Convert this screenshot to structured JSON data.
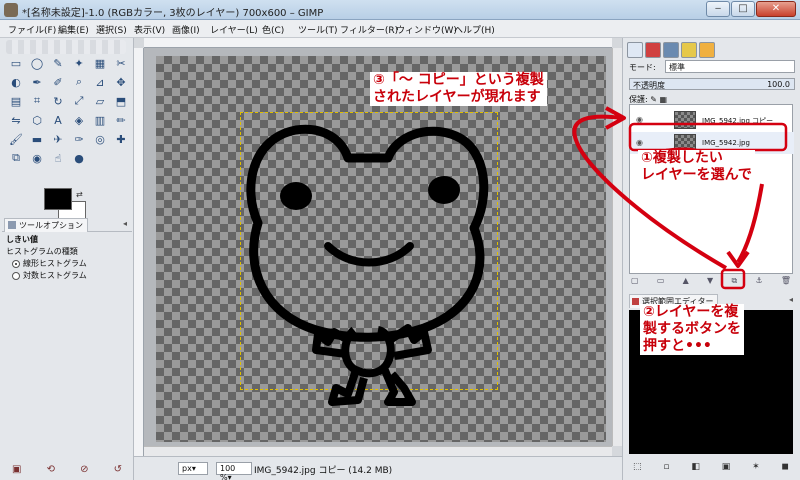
{
  "window": {
    "title": "*[名称未設定]-1.0 (RGBカラー, 3枚のレイヤー) 700x600 – GIMP",
    "minimize_icon": "minimize-icon",
    "maximize_icon": "maximize-icon",
    "close_icon": "close-icon",
    "minimize_glyph": "‒",
    "maximize_glyph": "□",
    "close_glyph": "✕"
  },
  "menubar": {
    "items": [
      "ファイル(F)",
      "編集(E)",
      "選択(S)",
      "表示(V)",
      "画像(I)",
      "レイヤー(L)",
      "色(C)",
      "ツール(T)",
      "フィルター(R)",
      "ウィンドウ(W)",
      "ヘルプ(H)"
    ]
  },
  "toolbox": {
    "tools": [
      {
        "icon": "rect-select-icon",
        "glyph": "▭"
      },
      {
        "icon": "ellipse-select-icon",
        "glyph": "◯"
      },
      {
        "icon": "lasso-select-icon",
        "glyph": "✎"
      },
      {
        "icon": "fuzzy-select-icon",
        "glyph": "✦"
      },
      {
        "icon": "color-select-icon",
        "glyph": "▦"
      },
      {
        "icon": "scissors-icon",
        "glyph": "✂"
      },
      {
        "icon": "foreground-select-icon",
        "glyph": "◐"
      },
      {
        "icon": "paths-icon",
        "glyph": "✒"
      },
      {
        "icon": "color-picker-icon",
        "glyph": "✐"
      },
      {
        "icon": "zoom-icon",
        "glyph": "⌕"
      },
      {
        "icon": "measure-icon",
        "glyph": "⊿"
      },
      {
        "icon": "move-icon",
        "glyph": "✥"
      },
      {
        "icon": "align-icon",
        "glyph": "▤"
      },
      {
        "icon": "crop-icon",
        "glyph": "⌗"
      },
      {
        "icon": "rotate-icon",
        "glyph": "↻"
      },
      {
        "icon": "scale-icon",
        "glyph": "⤢"
      },
      {
        "icon": "shear-icon",
        "glyph": "▱"
      },
      {
        "icon": "perspective-icon",
        "glyph": "⬒"
      },
      {
        "icon": "flip-icon",
        "glyph": "⇋"
      },
      {
        "icon": "cage-icon",
        "glyph": "⬡"
      },
      {
        "icon": "text-icon",
        "glyph": "A"
      },
      {
        "icon": "bucket-fill-icon",
        "glyph": "◈"
      },
      {
        "icon": "blend-icon",
        "glyph": "▥"
      },
      {
        "icon": "pencil-icon",
        "glyph": "✏"
      },
      {
        "icon": "paintbrush-icon",
        "glyph": "🖌"
      },
      {
        "icon": "eraser-icon",
        "glyph": "▬"
      },
      {
        "icon": "airbrush-icon",
        "glyph": "✈"
      },
      {
        "icon": "ink-icon",
        "glyph": "✑"
      },
      {
        "icon": "clone-icon",
        "glyph": "◎"
      },
      {
        "icon": "heal-icon",
        "glyph": "✚"
      },
      {
        "icon": "perspective-clone-icon",
        "glyph": "⧉"
      },
      {
        "icon": "blur-icon",
        "glyph": "◉"
      },
      {
        "icon": "smudge-icon",
        "glyph": "☝"
      },
      {
        "icon": "dodge-burn-icon",
        "glyph": "●"
      }
    ],
    "colors": {
      "foreground": "#000000",
      "background": "#ffffff"
    }
  },
  "tool_options": {
    "tab_label": "ツールオプション",
    "section_title": "しきい値",
    "histogram_label": "ヒストグラムの種類",
    "options": [
      {
        "label": "線形ヒストグラム",
        "checked": true
      },
      {
        "label": "対数ヒストグラム",
        "checked": false
      }
    ]
  },
  "statusbar": {
    "unit": "px▾",
    "zoom": "100 %▾",
    "status_text": "IMG_5942.jpg コピー (14.2 MB)"
  },
  "layers_panel": {
    "mode_label": "モード:",
    "mode_value": "標準",
    "opacity_label": "不透明度",
    "opacity_value": "100.0",
    "lock_label": "保護:",
    "layers": [
      {
        "name": "IMG_5942.jpg コピー",
        "visible": true,
        "selected": false
      },
      {
        "name": "IMG_5942.jpg",
        "visible": true,
        "selected": true
      }
    ]
  },
  "selection_editor": {
    "tab_label": "選択範囲エディター"
  },
  "annotations": {
    "callout_1_line1": "①複製したい",
    "callout_1_line2": "レイヤーを選んで",
    "callout_2_line1": "②レイヤーを複",
    "callout_2_line2": "製するボタンを",
    "callout_2_line3": "押すと•••",
    "callout_3_line1": "③「～ コピー」という複製",
    "callout_3_line2": "されたレイヤーが現れます",
    "color": "#d40010"
  }
}
